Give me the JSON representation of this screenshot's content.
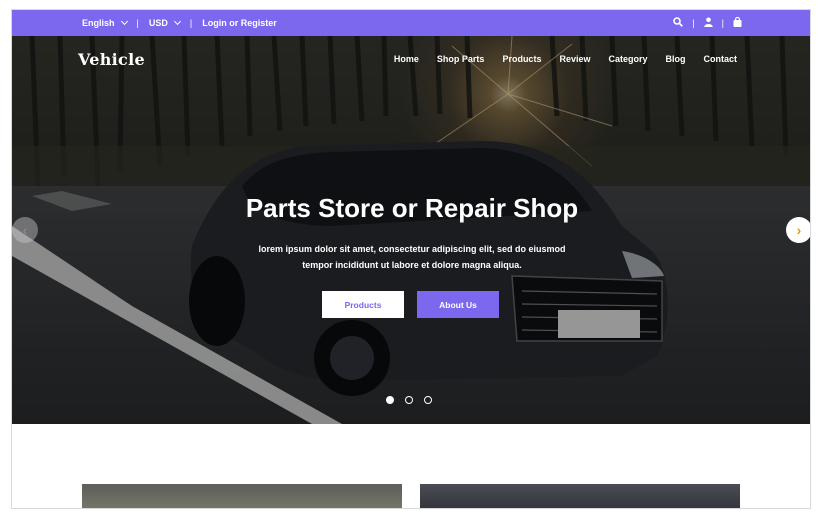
{
  "topbar": {
    "language": "English",
    "currency": "USD",
    "login": "Login or Register",
    "sep": "|",
    "icons": [
      "search-icon",
      "user-icon",
      "bag-icon"
    ]
  },
  "header": {
    "logo": "Vehicle",
    "nav": [
      "Home",
      "Shop Parts",
      "Products",
      "Review",
      "Category",
      "Blog",
      "Contact"
    ]
  },
  "hero": {
    "title": "Parts Store or Repair Shop",
    "subtitle_line1": "lorem ipsum dolor sit amet, consectetur adipiscing elit, sed do eiusmod",
    "subtitle_line2": "tempor incididunt ut labore et dolore magna aliqua.",
    "button_products": "Products",
    "button_about": "About Us",
    "slides": 3,
    "active_slide": 1
  },
  "colors": {
    "accent": "#7b68ee",
    "arrow_right": "#e6a000"
  }
}
